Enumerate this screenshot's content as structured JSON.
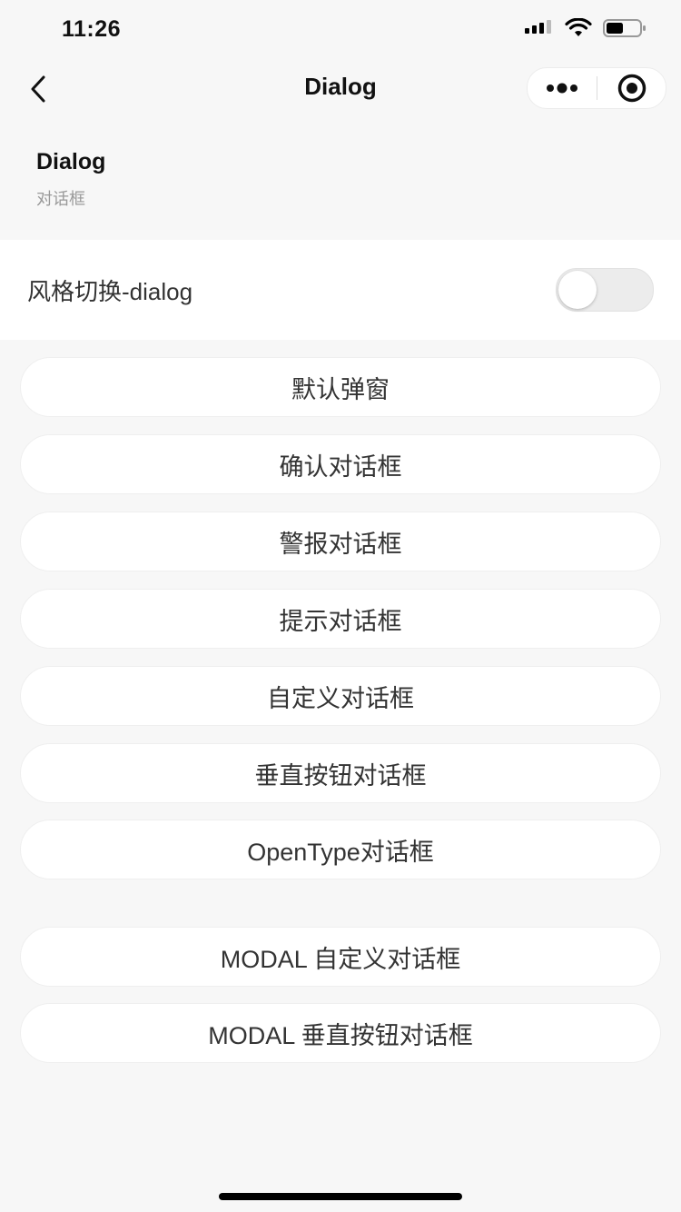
{
  "status_bar": {
    "time": "11:26"
  },
  "nav": {
    "title": "Dialog",
    "more_icon": "more-dots-icon",
    "close_icon": "target-close-icon",
    "back_icon": "chevron-left-icon"
  },
  "header": {
    "title": "Dialog",
    "subtitle": "对话框"
  },
  "style_switch": {
    "label": "风格切换-dialog",
    "on": false
  },
  "buttons": [
    {
      "label": "默认弹窗"
    },
    {
      "label": "确认对话框"
    },
    {
      "label": "警报对话框"
    },
    {
      "label": "提示对话框"
    },
    {
      "label": "自定义对话框"
    },
    {
      "label": "垂直按钮对话框"
    },
    {
      "label": "OpenType对话框"
    },
    {
      "label": "MODAL 自定义对话框"
    },
    {
      "label": "MODAL 垂直按钮对话框"
    }
  ]
}
